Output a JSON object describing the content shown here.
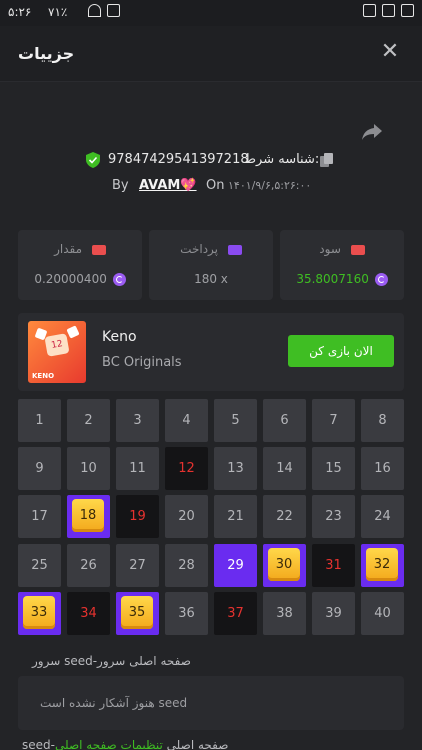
{
  "status_bar": {
    "time": "۵:۲۶",
    "battery": "۷۱٪"
  },
  "header": {
    "title": "جزییات"
  },
  "bet": {
    "id_label": "شناسه شرط:",
    "id": "97847429541397218",
    "by": "By",
    "user": "AVAM💖",
    "on": "On",
    "date": "۱۴۰۱/۹/۶,۵:۲۶:۰۰"
  },
  "stats": [
    {
      "label": "سود",
      "value": "35.8007160",
      "icon": "profit-icon",
      "color": "#ea4e4e"
    },
    {
      "label": "پرداخت",
      "value": "180 x",
      "icon": "card-icon",
      "color": "#8a4bf0"
    },
    {
      "label": "مقدار",
      "value": "0.20000400",
      "icon": "wager-icon",
      "color": "#ea4e4e"
    }
  ],
  "game": {
    "name": "Keno",
    "provider": "BC Originals",
    "play_label": "الان بازی کن",
    "thumb_text": "KENO",
    "thumb_number": "12"
  },
  "numbers": [
    "1",
    "2",
    "3",
    "4",
    "5",
    "6",
    "7",
    "8",
    "9",
    "10",
    "11",
    "12",
    "13",
    "14",
    "15",
    "16",
    "17",
    "18",
    "19",
    "20",
    "21",
    "22",
    "23",
    "24",
    "25",
    "26",
    "27",
    "28",
    "29",
    "30",
    "31",
    "32",
    "33",
    "34",
    "35",
    "36",
    "37",
    "38",
    "39",
    "40"
  ],
  "number_states": {
    "hit": [
      "18",
      "30",
      "32",
      "33",
      "35"
    ],
    "selected": [
      "29"
    ],
    "miss": [
      "12",
      "19",
      "31",
      "34",
      "37"
    ]
  },
  "seed": {
    "label": "سرور seed-صفحه اصلی سرور",
    "value": "هنوز آشکار نشده است seed"
  },
  "footer": {
    "text": "seed-صفحه اصلی ",
    "green": "تنظیمات صفحه اصلی"
  },
  "colors": {
    "background": "#232427",
    "accent_purple": "#6a2cf0",
    "play_green": "#3fbe23",
    "miss_red": "#e5322f",
    "hit_gold": "#ffd84a"
  }
}
